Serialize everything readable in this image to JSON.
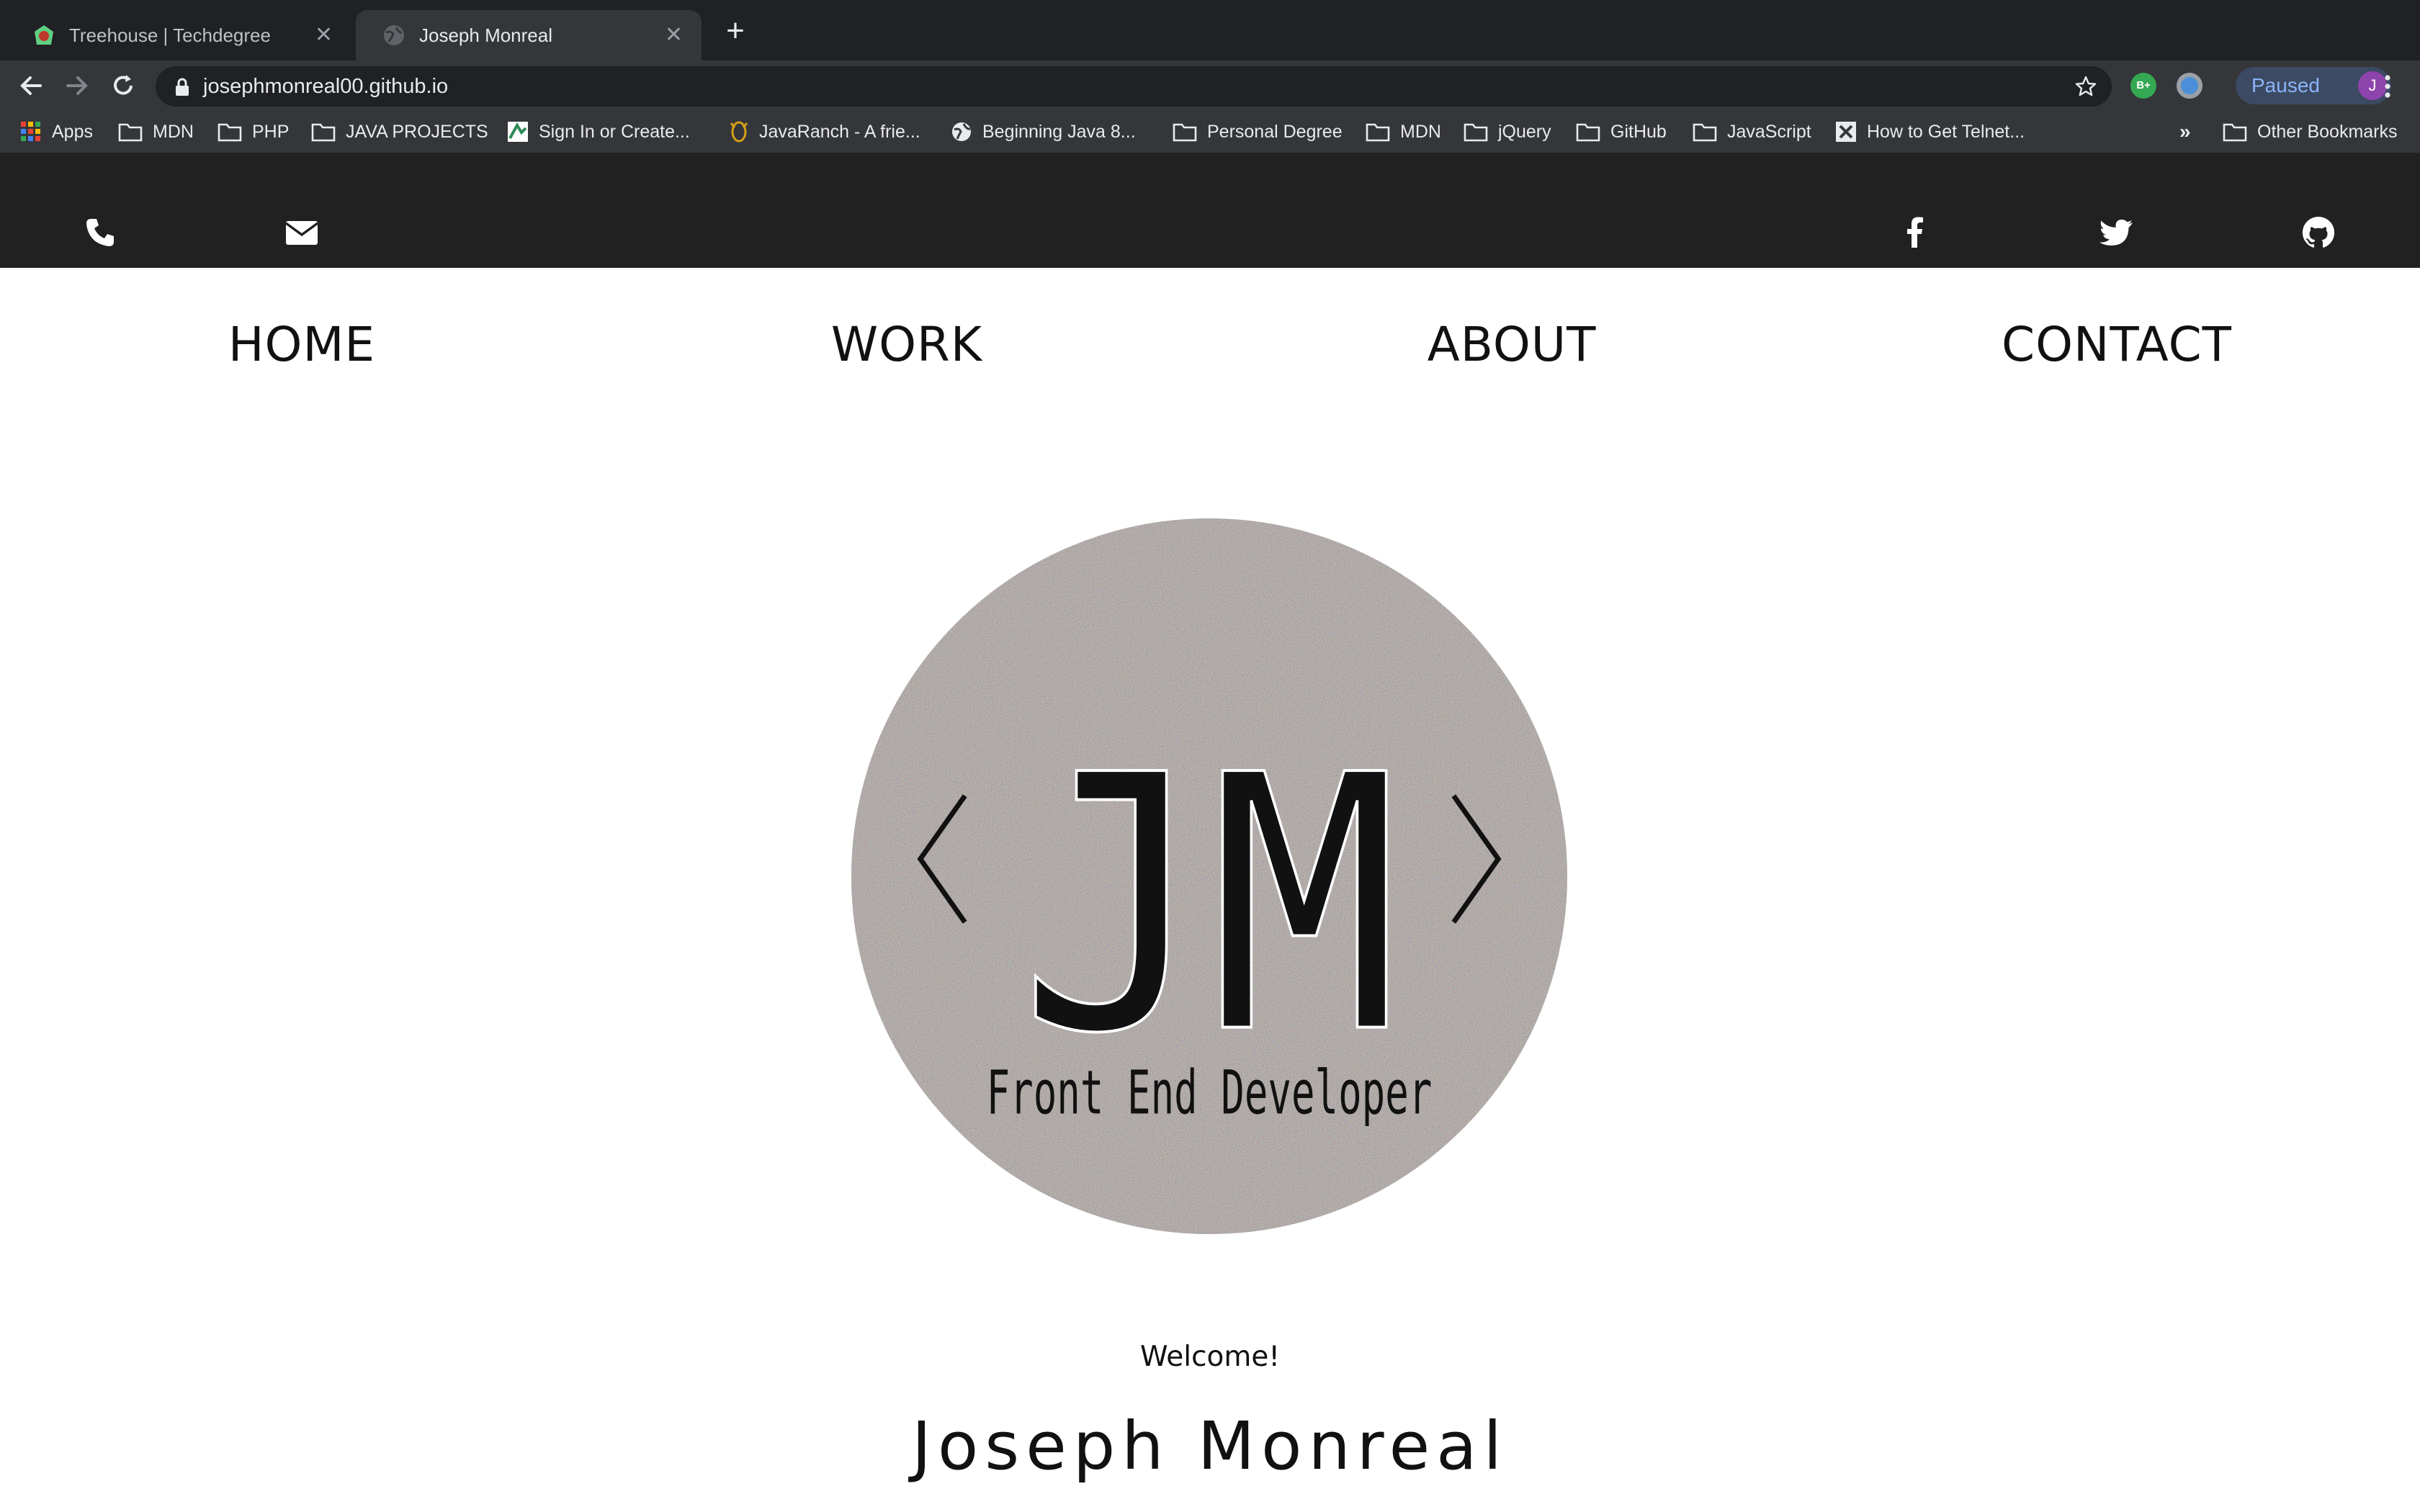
{
  "browser": {
    "tabs": [
      {
        "title": "Treehouse | Techdegree",
        "active": false
      },
      {
        "title": "Joseph Monreal",
        "active": true
      }
    ],
    "url": "josephmonreal00.github.io",
    "profile_status": "Paused",
    "profile_initial": "J",
    "bookmarks": [
      {
        "label": "Apps",
        "icon": "apps-grid-icon"
      },
      {
        "label": "MDN",
        "icon": "folder-icon"
      },
      {
        "label": "PHP",
        "icon": "folder-icon"
      },
      {
        "label": "JAVA PROJECTS",
        "icon": "folder-icon"
      },
      {
        "label": "Sign In or Create...",
        "icon": "site-favicon"
      },
      {
        "label": "JavaRanch - A frie...",
        "icon": "site-favicon"
      },
      {
        "label": "Beginning Java 8...",
        "icon": "globe-icon"
      },
      {
        "label": "Personal Degree",
        "icon": "folder-icon"
      },
      {
        "label": "MDN",
        "icon": "folder-icon"
      },
      {
        "label": "jQuery",
        "icon": "folder-icon"
      },
      {
        "label": "GitHub",
        "icon": "folder-icon"
      },
      {
        "label": "JavaScript",
        "icon": "folder-icon"
      },
      {
        "label": "How to Get Telnet...",
        "icon": "site-favicon"
      }
    ],
    "bookmarks_overflow": "»",
    "other_bookmarks": "Other Bookmarks",
    "colors": {
      "tabstrip": "#202124",
      "toolbar": "#35363a",
      "text": "#e8eaed",
      "paused_accent": "#8ab4f8"
    }
  },
  "site": {
    "contact_icons": [
      "phone-icon",
      "envelope-icon"
    ],
    "social_icons": [
      "facebook-icon",
      "twitter-icon",
      "github-icon"
    ],
    "nav": [
      "HOME",
      "WORK",
      "ABOUT",
      "CONTACT"
    ],
    "logo": {
      "monogram": "JM",
      "tagline": "Front End Developer"
    },
    "welcome": "Welcome!",
    "name": "Joseph Monreal",
    "colors": {
      "topbar": "#212121",
      "text": "#111111"
    }
  }
}
